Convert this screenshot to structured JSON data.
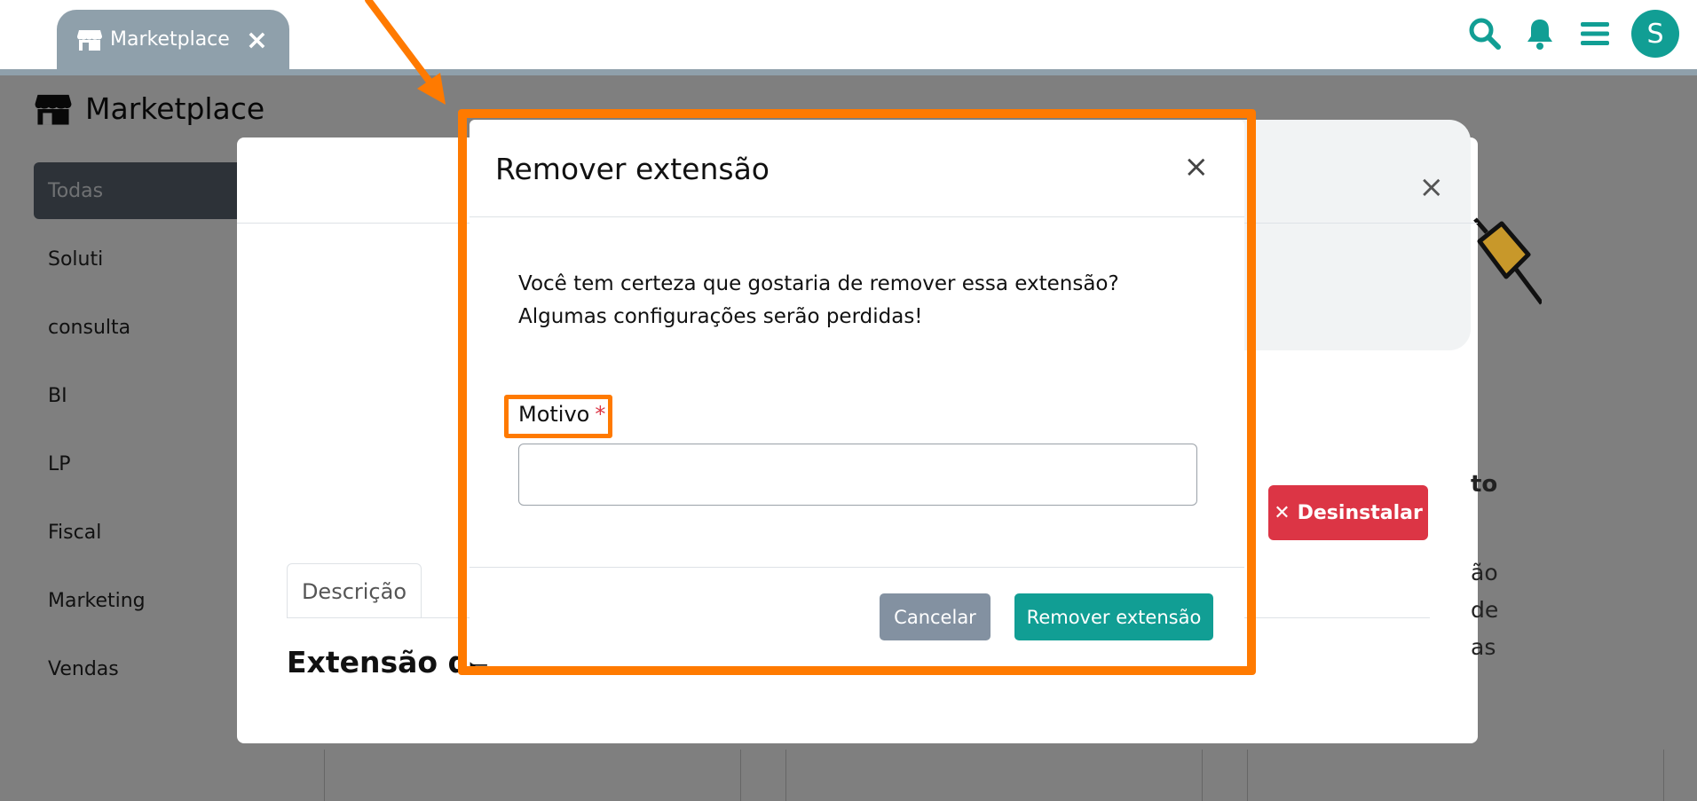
{
  "tab": {
    "label": "Marketplace",
    "close": "×"
  },
  "page": {
    "title": "Marketplace"
  },
  "sidebar": {
    "items": [
      {
        "label": "Todas"
      },
      {
        "label": "Soluti"
      },
      {
        "label": "consulta"
      },
      {
        "label": "BI"
      },
      {
        "label": "LP"
      },
      {
        "label": "Fiscal"
      },
      {
        "label": "Marketing"
      },
      {
        "label": "Vendas"
      }
    ]
  },
  "user": {
    "initial": "S"
  },
  "detail_modal": {
    "close": "×",
    "uninstall_label": "Desinstalar",
    "tab_description": "Descrição",
    "heading": "Extensão de",
    "side_title": "to",
    "side_text_1": "ão de",
    "side_text_2": "as"
  },
  "remove_modal": {
    "title": "Remover extensão",
    "close": "×",
    "message": "Você tem certeza que gostaria de remover essa extensão? Algumas configurações serão perdidas!",
    "field_label": "Motivo",
    "required_mark": "*",
    "field_value": "",
    "cancel_label": "Cancelar",
    "confirm_label": "Remover extensão"
  },
  "colors": {
    "accent": "#119e94",
    "danger": "#dc3545",
    "highlight": "#ff7a00",
    "tab_bg": "#8fa0ab",
    "cancel_bg": "#8391a1"
  }
}
